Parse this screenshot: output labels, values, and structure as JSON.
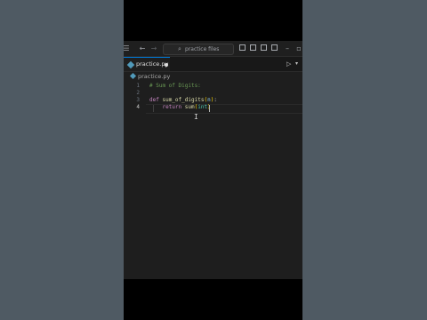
{
  "search": {
    "placeholder": "practice files"
  },
  "tab": {
    "filename": "practice.py"
  },
  "breadcrumb": {
    "filename": "practice.py"
  },
  "editor": {
    "line_numbers": [
      "1",
      "2",
      "3",
      "4"
    ],
    "active_line": 4,
    "lines": [
      {
        "comment": "# Sum of Digits:"
      },
      {},
      {
        "kw": "def",
        "fn": "sum_of_digits",
        "open": "(",
        "param": "n",
        "close": ")",
        "colon": ":"
      },
      {
        "kw": "return",
        "fn": "sum",
        "open": "(",
        "type": "int",
        "close": ")"
      }
    ]
  },
  "icons": {
    "menu": "hamburger-icon",
    "back": "arrow-left-icon",
    "forward": "arrow-right-icon",
    "search": "magnifier-icon",
    "run": "play-icon"
  },
  "colors": {
    "background": "#4f5a63",
    "editor": "#1e1e1e",
    "accent": "#0078d4",
    "python_icon": "#519aba"
  }
}
